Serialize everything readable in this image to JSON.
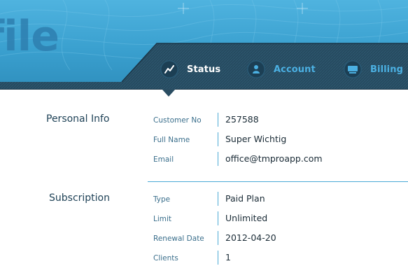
{
  "header": {
    "title": "file",
    "colors": {
      "accent": "#3aa0cf",
      "band": "#2a4d62",
      "tab_active": "#ffffff",
      "tab_inactive": "#4bb0e2"
    }
  },
  "tabs": [
    {
      "label": "Status",
      "icon": "trend-chart-icon",
      "active": true
    },
    {
      "label": "Account",
      "icon": "user-icon",
      "active": false
    },
    {
      "label": "Billing",
      "icon": "card-icon",
      "active": false
    }
  ],
  "personal_info": {
    "title": "Personal Info",
    "rows": [
      {
        "label": "Customer No",
        "value": "257588"
      },
      {
        "label": "Full Name",
        "value": "Super Wichtig"
      },
      {
        "label": "Email",
        "value": "office@tmproapp.com"
      }
    ]
  },
  "subscription": {
    "title": "Subscription",
    "rows": [
      {
        "label": "Type",
        "value": "Paid Plan"
      },
      {
        "label": "Limit",
        "value": "Unlimited"
      },
      {
        "label": "Renewal Date",
        "value": "2012-04-20"
      },
      {
        "label": "Clients",
        "value": "1"
      }
    ]
  }
}
